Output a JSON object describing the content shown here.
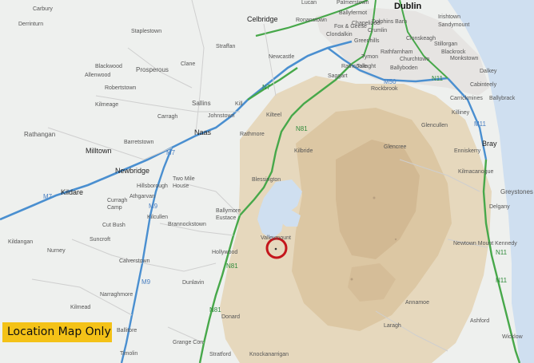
{
  "map": {
    "colors": {
      "land": "#eef0ee",
      "mountain": "#e3d2b2",
      "water": "#cfdff0",
      "road_primary": "#47a84a",
      "road_motorway": "#4a8fd0",
      "marker": "#c4161c"
    },
    "city": {
      "dublin": "Dublin"
    },
    "big_towns": {
      "naas": "Naas",
      "kildare": "Kildare",
      "newbridge": "Newbridge",
      "milltown": "Milltown",
      "celbridge": "Celbridge",
      "bray": "Bray"
    },
    "towns": {
      "carbury": "Carbury",
      "derrinturn": "Derrinturn",
      "staplestown": "Staplestown",
      "straffan": "Straffan",
      "blackwood": "Blackwood",
      "prosperous": "Prosperous",
      "clane": "Clane",
      "allenwood": "Allenwood",
      "robertstown": "Robertstown",
      "kilmeage": "Kilmeage",
      "sallins": "Sallins",
      "carragh": "Carragh",
      "rathangan": "Rathangan",
      "johnstown": "Johnstown",
      "rathmore": "Rathmore",
      "kill": "Kill",
      "kilteel": "Kilteel",
      "barretstown": "Barretstown",
      "newcastle": "Newcastle",
      "saggart": "Saggart",
      "tallaght": "Tallaght",
      "rathcoole": "Rathcoole",
      "kilbride": "Kilbride",
      "blessington": "Blessington",
      "two_mile_house": "Two Mile\nHouse",
      "hillsborough": "Hillsborough",
      "athgarvan": "Athgarvan",
      "curragh_camp": "Curragh\nCamp",
      "kilcullen": "Kilcullen",
      "brannockstown": "Brannockstown",
      "ballymore_eustace": "Ballymore\nEustace",
      "cut_bush": "Cut Bush",
      "suncroft": "Suncroft",
      "kildangan": "Kildangan",
      "nurney": "Nurney",
      "calverstown": "Calverstown",
      "hollywood": "Hollywood",
      "valleymount": "Valleymount",
      "dunlavin": "Dunlavin",
      "narraghmore": "Narraghmore",
      "kilmead": "Kilmead",
      "ballitore": "Ballitore",
      "timolin": "Timolin",
      "donard": "Donard",
      "grange_con": "Grange Con",
      "stratford": "Stratford",
      "knockanarrigan": "Knockanarrigan",
      "laragh": "Laragh",
      "annamoe": "Annamoe",
      "ashford": "Ashford",
      "wicklow": "Wicklow",
      "newtown_mount_kennedy": "Newtown Mount Kennedy",
      "delgany": "Delgany",
      "greystones": "Greystones",
      "kilmacanogue": "Kilmacanogue",
      "enniskerry": "Enniskerry",
      "glencree": "Glencree",
      "glencullen": "Glencullen",
      "killiney": "Killiney",
      "cabinteely": "Cabinteely",
      "carrickmines": "Carrickmines",
      "ballybrack": "Ballybrack",
      "dalkey": "Dalkey",
      "monkstown": "Monkstown",
      "blackrock": "Blackrock",
      "stillorgan": "Stillorgan",
      "churchtown": "Churchtown",
      "rathfarnham": "Rathfarnham",
      "ballyboden": "Ballyboden",
      "rockbrook": "Rockbrook",
      "clondalkin": "Clondalkin",
      "greenhills": "Greenhills",
      "lucan": "Lucan",
      "palmerstown": "Palmerstown",
      "ballyfermot": "Ballyfermot",
      "chapelizod": "Chapelizod",
      "ronanstown": "Ronanstown",
      "fox_and_geese": "Fox & Geese",
      "dolphins_barn": "Dolphins Barn",
      "crumlin": "Crumlin",
      "tymon": "Tymon",
      "irishtown": "Irishtown",
      "sandymount": "Sandymount",
      "clonskeagh": "Clonskeagh"
    },
    "roads": {
      "m7_west": "M7",
      "m7_mid": "M7",
      "m9_a": "M9",
      "m9_b": "M9",
      "n7": "N7",
      "n81_a": "N81",
      "n81_b": "N81",
      "n81_c": "N81",
      "m50": "M50",
      "n11_a": "N11",
      "n11_b": "N11",
      "n11_c": "N11",
      "m11": "M11"
    },
    "badge": "Location Map Only"
  }
}
